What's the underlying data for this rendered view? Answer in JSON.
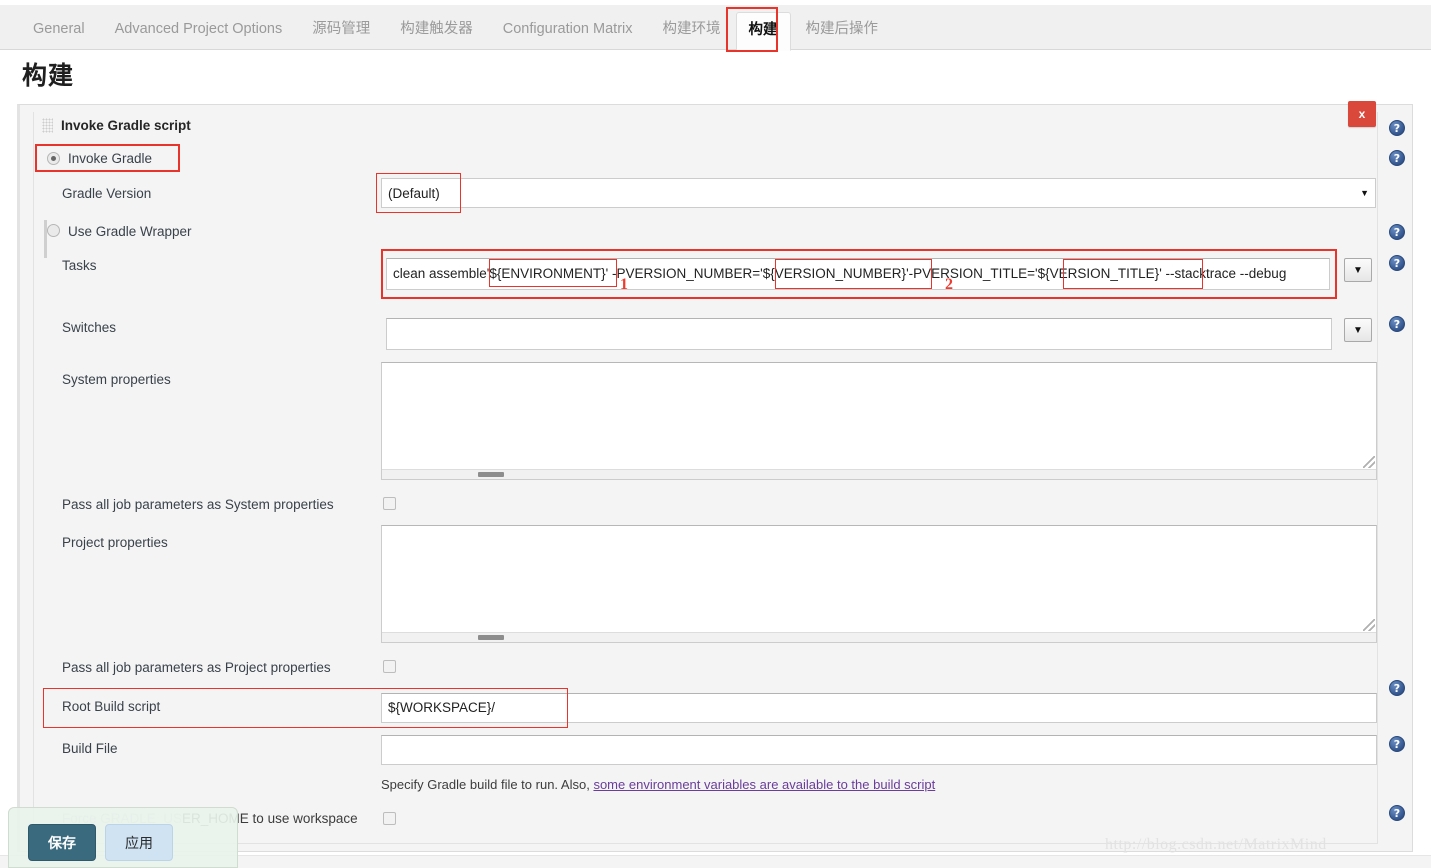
{
  "tabs": [
    {
      "label": "General",
      "active": false
    },
    {
      "label": "Advanced Project Options",
      "active": false
    },
    {
      "label": "源码管理",
      "active": false
    },
    {
      "label": "构建触发器",
      "active": false
    },
    {
      "label": "Configuration Matrix",
      "active": false
    },
    {
      "label": "构建环境",
      "active": false
    },
    {
      "label": "构建",
      "active": true
    },
    {
      "label": "构建后操作",
      "active": false
    }
  ],
  "page": {
    "title": "构建"
  },
  "section": {
    "title": "Invoke Gradle script",
    "delete_label": "x"
  },
  "fields": {
    "invoke_gradle_label": "Invoke Gradle",
    "gradle_version_label": "Gradle Version",
    "gradle_version_value": "(Default)",
    "use_gradle_wrapper_label": "Use Gradle Wrapper",
    "tasks_label": "Tasks",
    "tasks_value": "clean assemble'${ENVIRONMENT}' -PVERSION_NUMBER='${VERSION_NUMBER}'-PVERSION_TITLE='${VERSION_TITLE}' --stacktrace --debug",
    "tasks_part_1": "clean assemble'",
    "tasks_part_2": "${ENVIRONMENT}",
    "tasks_part_3": "' -PVERSION_NUMBER='",
    "tasks_part_4": "${VERSION_NUMBER}",
    "tasks_part_5": "'-PVERSION_TITLE='",
    "tasks_part_6": "${VERSION_TITLE}",
    "tasks_part_7": "' --stacktrace --debug",
    "switches_label": "Switches",
    "switches_value": "",
    "system_properties_label": "System properties",
    "system_properties_value": "",
    "pass_system_label": "Pass all job parameters as System properties",
    "project_properties_label": "Project properties",
    "project_properties_value": "",
    "pass_project_label": "Pass all job parameters as Project properties",
    "root_build_script_label": "Root Build script",
    "root_build_script_value": "${WORKSPACE}/",
    "build_file_label": "Build File",
    "build_file_value": "",
    "build_file_help_prefix": "Specify Gradle build file to run. Also, ",
    "build_file_help_link": "some environment variables are available to the build script",
    "force_home_label_dim": "Force GRADLE_US",
    "force_home_label_rest": "ER_HOME to use workspace"
  },
  "annotations": {
    "marker_1": "1",
    "marker_2": "2"
  },
  "footer": {
    "save_label": "保存",
    "apply_label": "应用",
    "watermark": "http://blog.csdn.net/MatrixMind"
  },
  "icons": {
    "help": "?",
    "caret_down": "▼"
  },
  "colors": {
    "annotation_red": "#e8342a",
    "save_teal": "#396a7d",
    "apply_blue": "#cfe3f3",
    "delete_red": "#d9483b"
  }
}
